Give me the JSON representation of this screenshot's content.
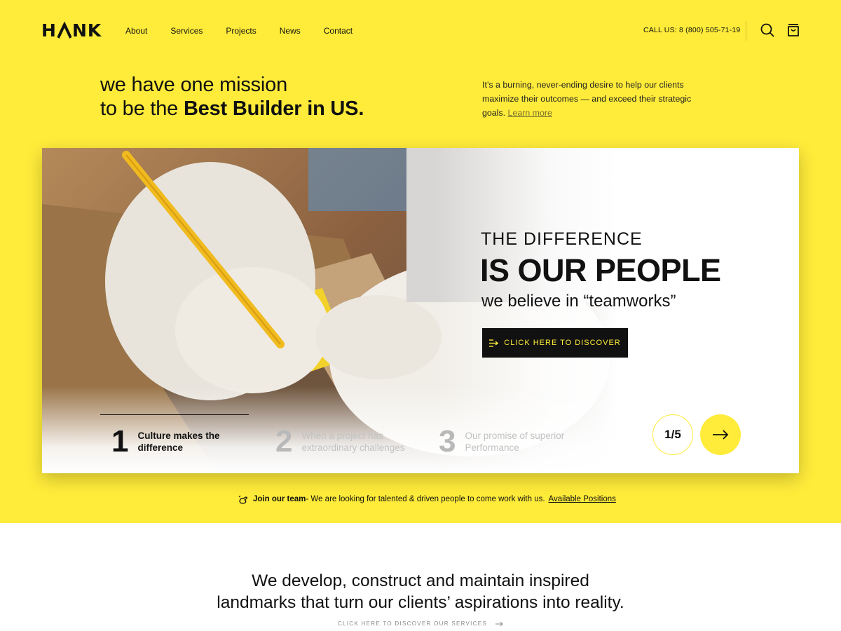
{
  "header": {
    "logo": "HANK",
    "nav": [
      "About",
      "Services",
      "Projects",
      "News",
      "Contact"
    ],
    "call": "CALL US: 8 (800) 505-71-19",
    "icons": [
      "search-icon",
      "cart-icon"
    ]
  },
  "mission": {
    "line1": "we have one mission",
    "line2_prefix": "to be the ",
    "line2_bold": "Best Builder in US.",
    "side_text": "It’s a burning, never-ending desire to help our clients maximize their outcomes — and exceed their strategic goals.",
    "learn_more": "Learn more"
  },
  "hero": {
    "eyebrow": "THE DIFFERENCE",
    "title": "IS OUR PEOPLE",
    "subtitle": "we believe in “teamworks”",
    "cta": "CLICK HERE TO DISCOVER",
    "slides": [
      {
        "num": "1",
        "line1": "Culture makes the",
        "line2": "difference"
      },
      {
        "num": "2",
        "line1": "When a project has",
        "line2": "extraordinary challenges"
      },
      {
        "num": "3",
        "line1": "Our promise of superior",
        "line2": "Performance"
      }
    ],
    "counter": "1/5",
    "active_slide": 1,
    "total_slides": 5
  },
  "join": {
    "bold": "Join our team",
    "text": " - We are looking for talented & driven people to come work with us.",
    "link": "Available Positions"
  },
  "bottom": {
    "tagline1": "We develop, construct and maintain inspired",
    "tagline2": "landmarks that turn our clients’ aspirations into reality.",
    "discover": "CLICK HERE TO DISCOVER OUR SERVICES"
  },
  "colors": {
    "accent": "#feeb3a",
    "dark": "#111111",
    "muted": "#8a8a8a"
  }
}
